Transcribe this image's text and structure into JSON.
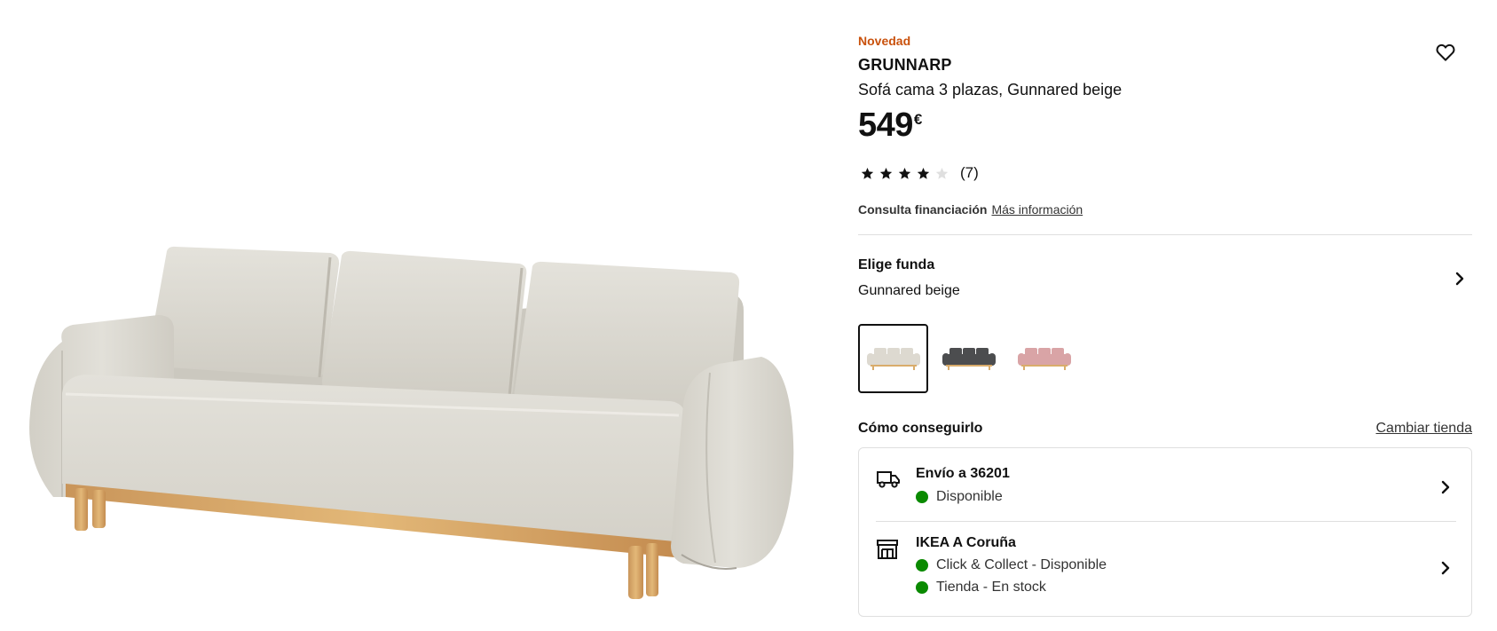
{
  "product": {
    "badge": "Novedad",
    "name": "GRUNNARP",
    "description": "Sofá cama 3 plazas, Gunnared beige",
    "price": "549",
    "currency": "€",
    "rating_value": 4,
    "rating_max": 5,
    "rating_count": "(7)"
  },
  "financing": {
    "label": "Consulta financiación",
    "link": "Más información"
  },
  "cover": {
    "title": "Elige funda",
    "selected": "Gunnared beige",
    "swatches": [
      {
        "name": "beige",
        "color": "#ddd9d0",
        "selected": true
      },
      {
        "name": "dark grey",
        "color": "#4c4d4f",
        "selected": false
      },
      {
        "name": "pink",
        "color": "#d9a4a6",
        "selected": false
      }
    ]
  },
  "availability": {
    "title": "Cómo conseguirlo",
    "change_store": "Cambiar tienda",
    "delivery": {
      "title": "Envío a 36201",
      "status": "Disponible"
    },
    "store": {
      "title": "IKEA A Coruña",
      "status_1": "Click & Collect - Disponible",
      "status_2": "Tienda - En stock"
    }
  },
  "colors": {
    "accent_new": "#c9510c",
    "available": "#0a8a00",
    "sofa_fabric": "#dedcd4",
    "wood": "#d9ac6b"
  }
}
